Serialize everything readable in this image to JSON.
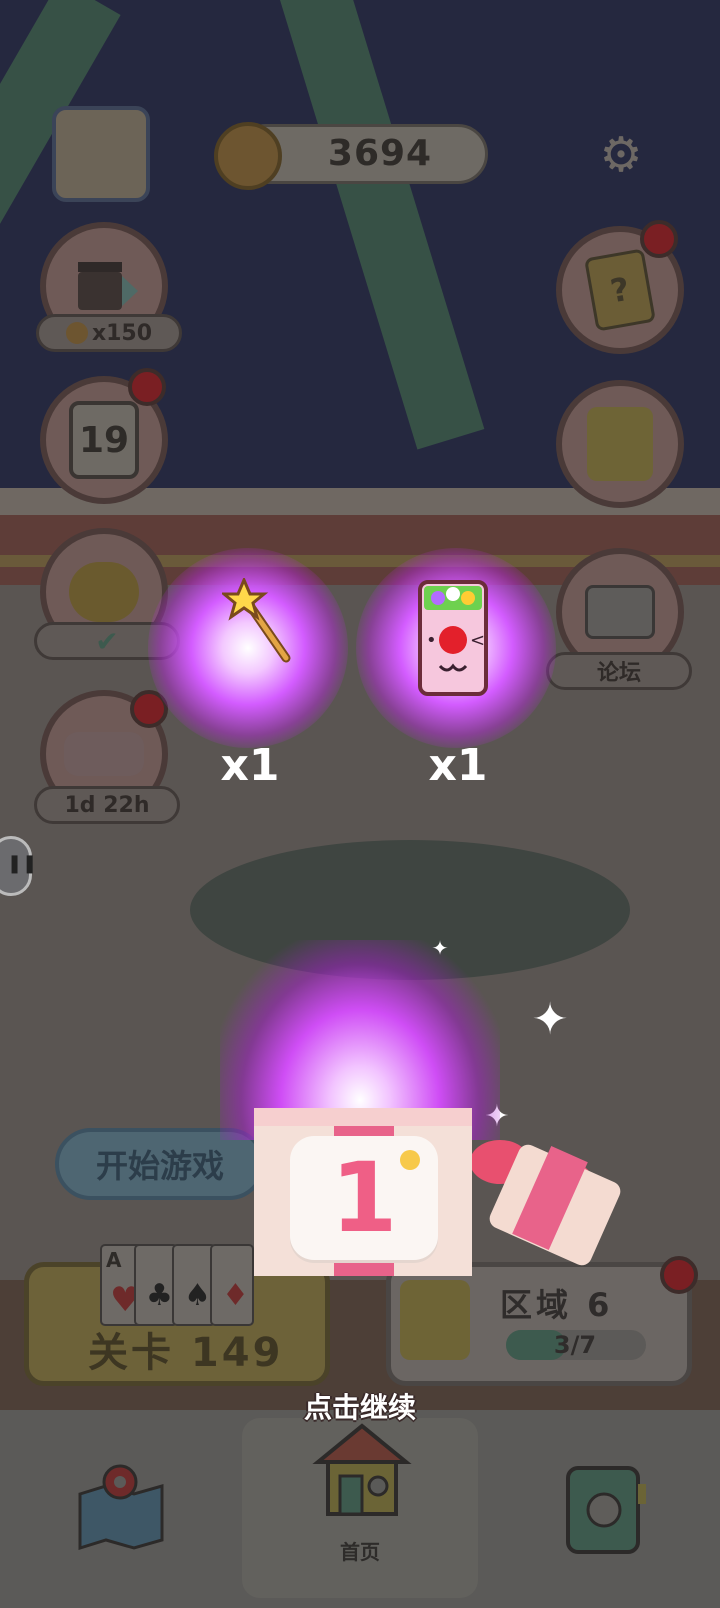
{
  "header": {
    "coins": "3694"
  },
  "left_buttons": {
    "ad_reward": "x150",
    "calendar_day": "19",
    "car_timer": "1d 22h"
  },
  "right_buttons": {
    "forum_label": "论坛"
  },
  "rewards": [
    {
      "icon": "magic-wand-icon",
      "count": "x1"
    },
    {
      "icon": "clown-card-icon",
      "count": "x1"
    }
  ],
  "gift": {
    "number": "1"
  },
  "start_button": "开始游戏",
  "level_card": {
    "label": "关卡 149",
    "card_ranks": [
      "A",
      "",
      "",
      ""
    ]
  },
  "region_card": {
    "title": "区域 6",
    "progress": "3/7",
    "progress_fraction": 0.43
  },
  "overlay": {
    "tap_continue": "点击继续"
  },
  "bottom_nav": {
    "home_label": "首页"
  },
  "colors": {
    "glow": "#d35cff",
    "ribbon": "#e8638a",
    "box": "#f4e0d8"
  }
}
